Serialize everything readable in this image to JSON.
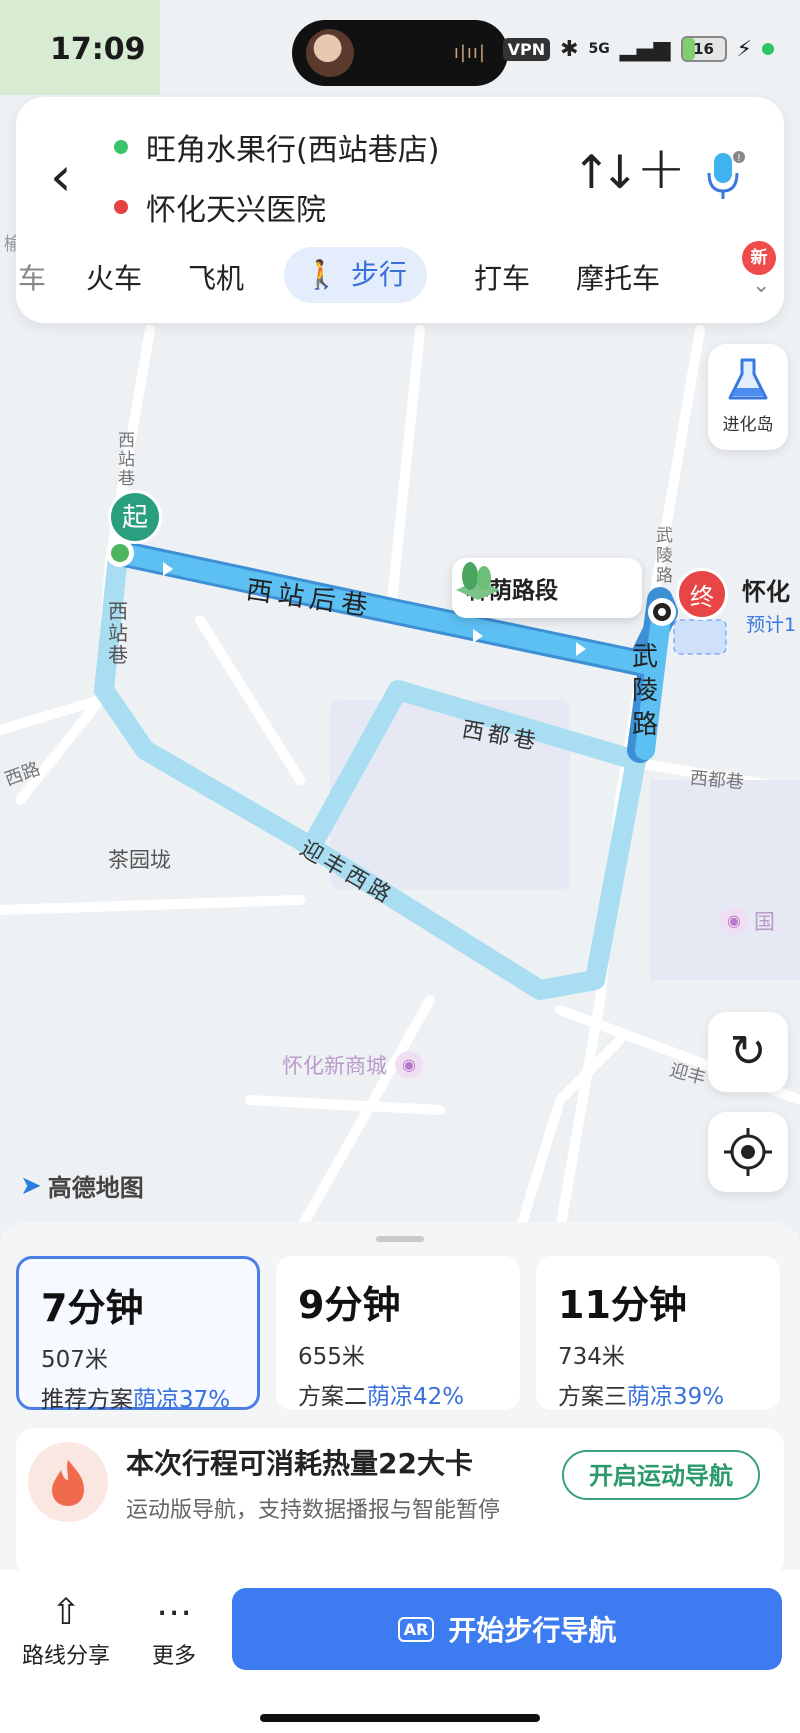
{
  "status": {
    "time": "17:09",
    "vpn": "VPN",
    "network": "5G",
    "battery": "16"
  },
  "route_header": {
    "start": "旺角水果行(西站巷店)",
    "end": "怀化天兴医院",
    "modes": [
      "车",
      "火车",
      "飞机",
      "步行",
      "打车",
      "摩托车"
    ],
    "selected_mode": "步行",
    "new_badge": "新"
  },
  "map": {
    "jinhua_label": "进化岛",
    "segment_label": "林荫路段",
    "start_marker": "起",
    "end_marker": "终",
    "end_name": "怀化",
    "end_sub": "预计1",
    "streets": {
      "xizhan_hou": "西站后巷",
      "xizhan": "西站巷",
      "xizhan_top": "西站巷",
      "wuling": "武陵路",
      "wuling_top": "武陵路",
      "xidu": "西都巷",
      "xidu_right": "西都巷",
      "yingfeng_xi": "迎丰西路",
      "yingfeng_right": "迎丰",
      "chayuan": "茶园垅",
      "shangcheng": "怀化新商城",
      "guoji": "国",
      "xilu": "西路",
      "yu": "榆"
    },
    "logo": "高德地图"
  },
  "routes": [
    {
      "time": "7分钟",
      "distance": "507米",
      "name": "推荐方案",
      "shade": "荫凉37%"
    },
    {
      "time": "9分钟",
      "distance": "655米",
      "name": "方案二",
      "shade": "荫凉42%"
    },
    {
      "time": "11分钟",
      "distance": "734米",
      "name": "方案三",
      "shade": "荫凉39%"
    }
  ],
  "calorie": {
    "headline": "本次行程可消耗热量22大卡",
    "sub": "运动版导航，支持数据播报与智能暂停",
    "button": "开启运动导航"
  },
  "bottom": {
    "share": "路线分享",
    "more": "更多",
    "start_ar": "AR",
    "start": "开始步行导航"
  }
}
